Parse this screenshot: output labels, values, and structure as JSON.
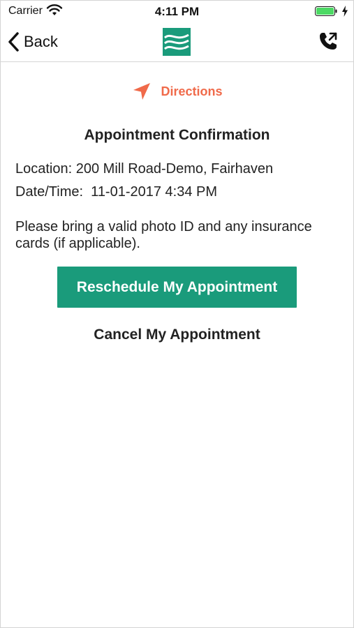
{
  "status_bar": {
    "carrier": "Carrier",
    "time": "4:11 PM",
    "battery_color": "#4cd964"
  },
  "nav": {
    "back_label": "Back"
  },
  "brand": {
    "accent": "#1a9b7b",
    "directions_color": "#f06a4a"
  },
  "directions": {
    "label": "Directions"
  },
  "confirmation": {
    "title": "Appointment Confirmation",
    "location": "Location: 200 Mill Road-Demo, Fairhaven",
    "datetime": "Date/Time:  11-01-2017 4:34 PM",
    "note": "Please bring a valid photo ID and any insurance cards (if applicable)."
  },
  "actions": {
    "reschedule_label": "Reschedule My Appointment",
    "cancel_label": "Cancel My Appointment"
  }
}
